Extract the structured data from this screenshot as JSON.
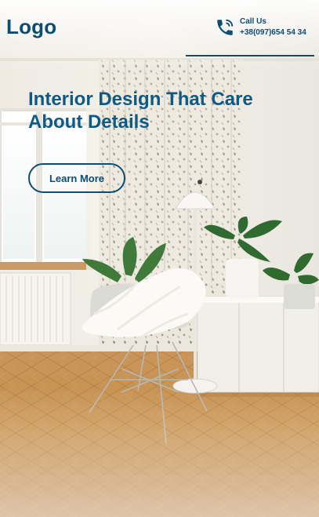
{
  "header": {
    "logo": "Logo",
    "call_label": "Call Us",
    "call_number": "+38(097)654 54 34",
    "phone_icon": "phone-icon"
  },
  "hero": {
    "title": "Interior Design That Care About Details",
    "cta_label": "Learn More"
  },
  "background": {
    "description_icons": [
      "window",
      "patterned-curtain",
      "radiator",
      "white-chair",
      "floor-lamp",
      "potted-plant",
      "sideboard",
      "parquet-floor"
    ]
  },
  "colors": {
    "brand": "#0d4d73",
    "title": "#0d5a85"
  }
}
